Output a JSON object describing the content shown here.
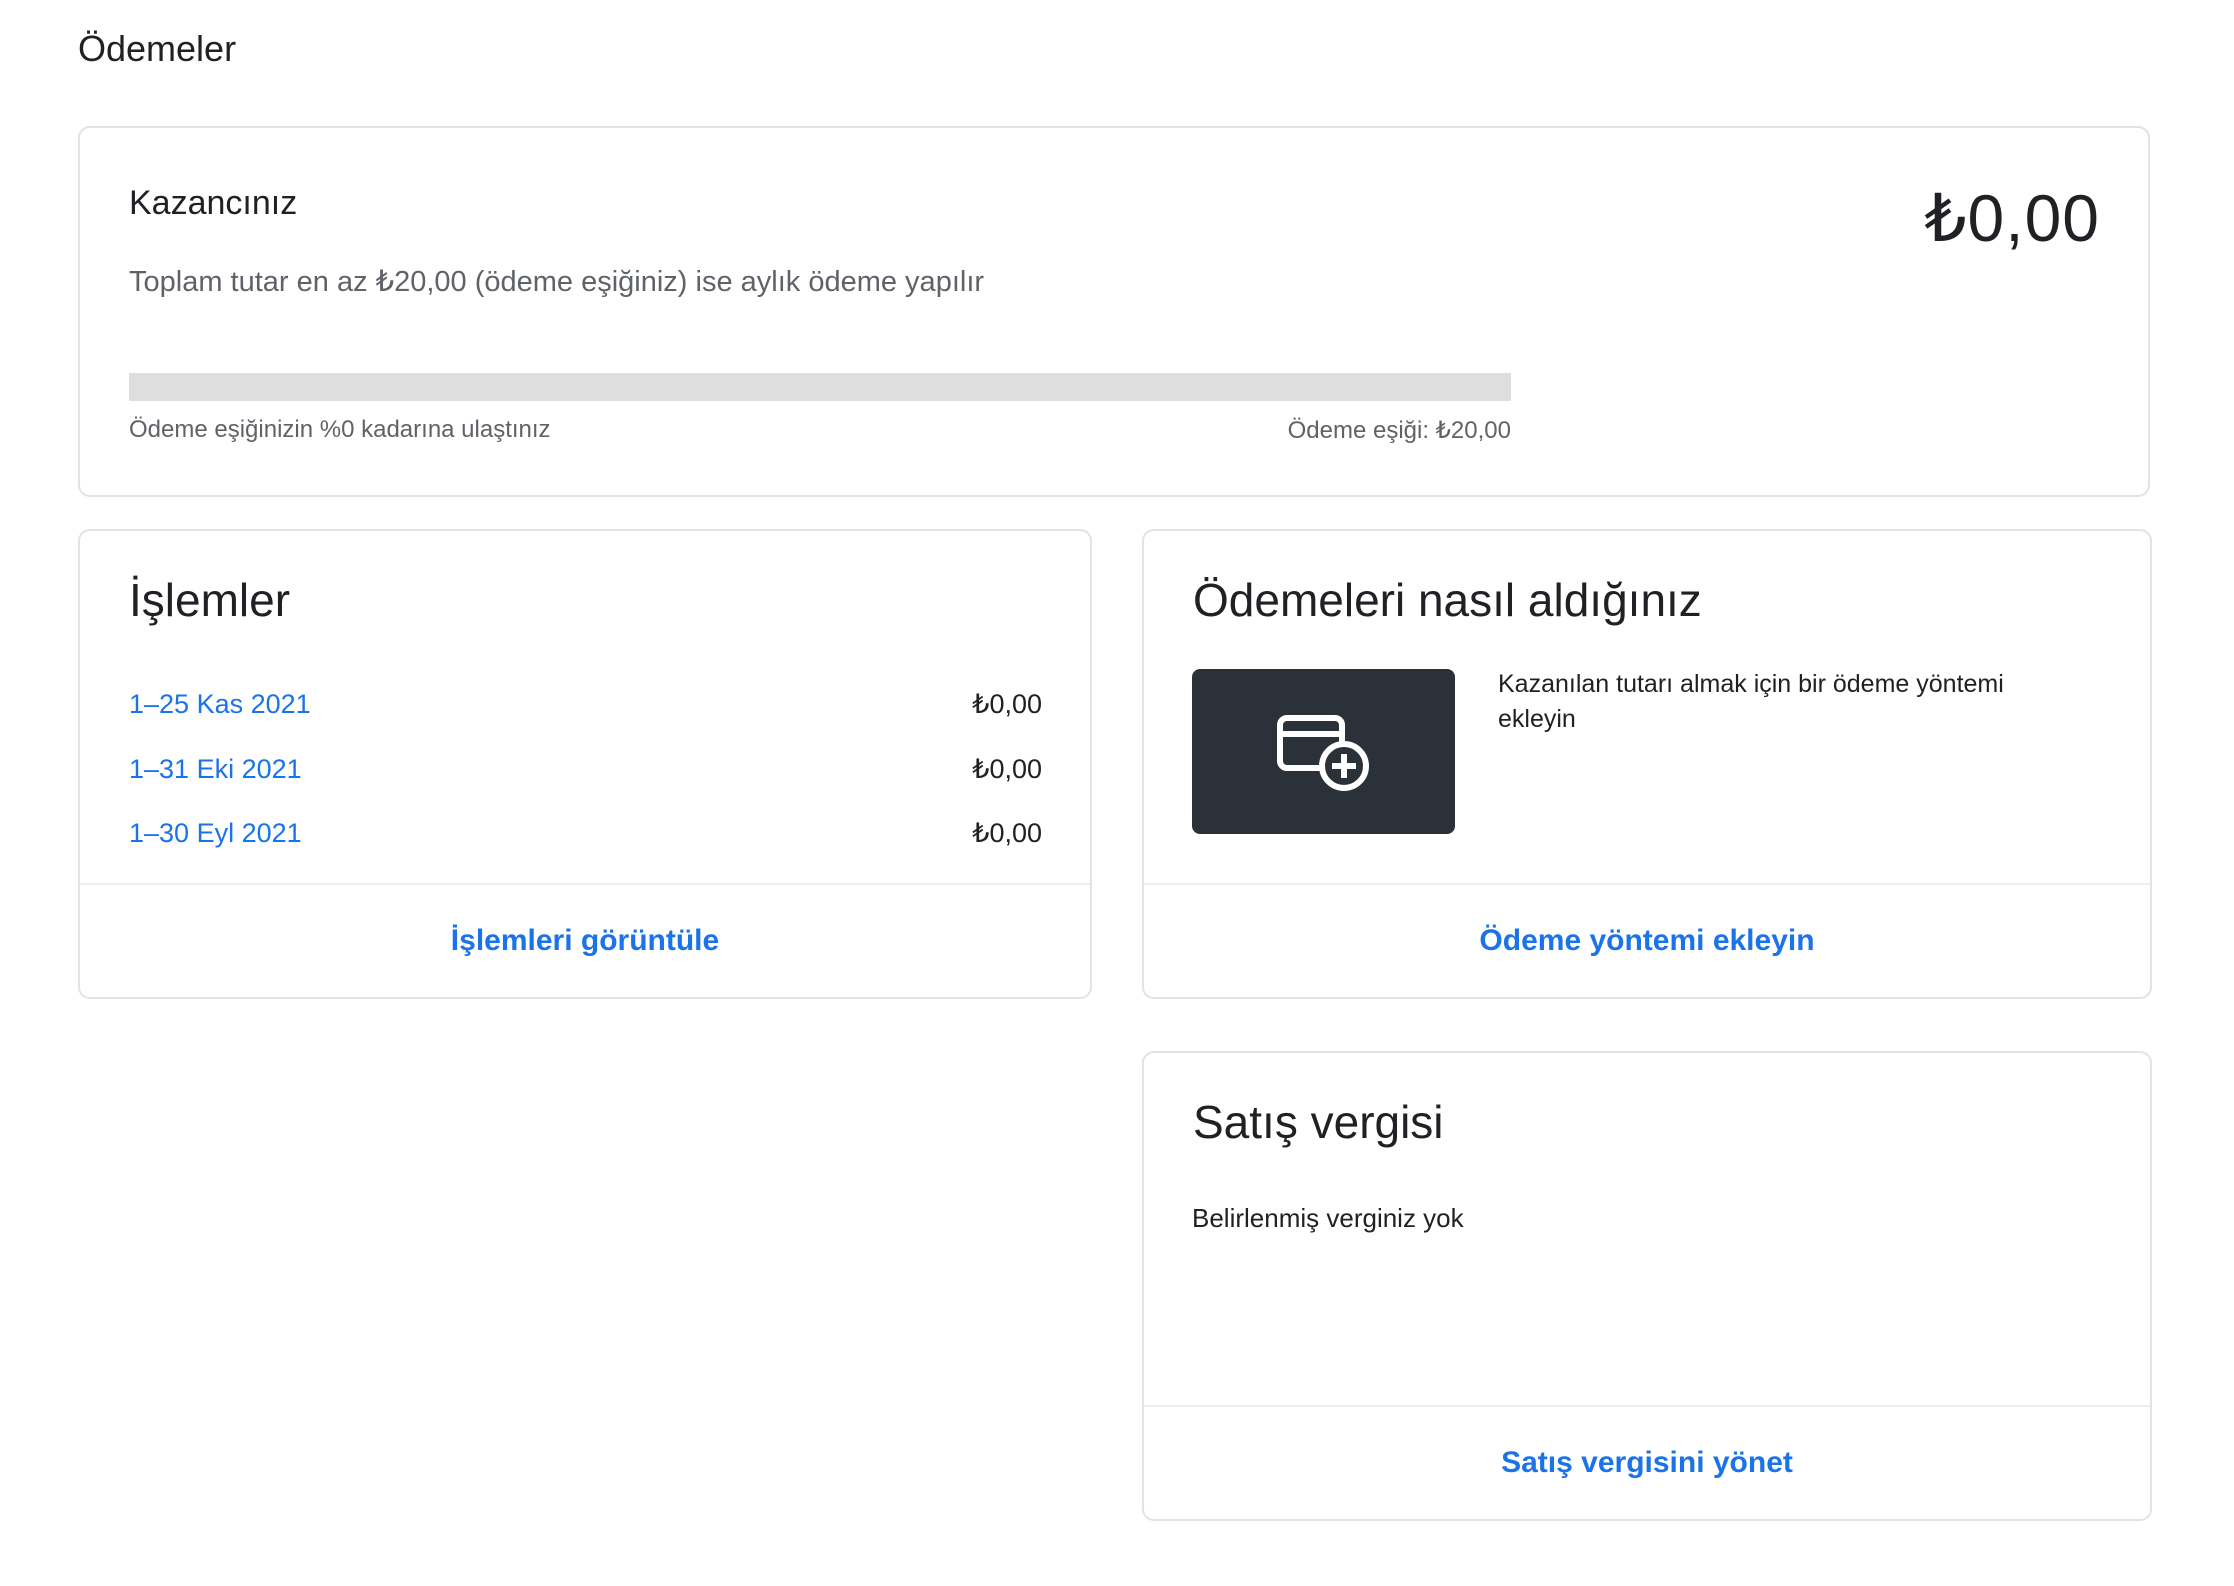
{
  "page": {
    "title": "Ödemeler"
  },
  "earnings": {
    "label": "Kazancınız",
    "amount": "₺0,00",
    "description": "Toplam tutar en az ₺20,00 (ödeme eşiğiniz) ise aylık ödeme yapılır",
    "progress_percent": 0,
    "progress_left_text": "Ödeme eşiğinizin %0 kadarına ulaştınız",
    "progress_right_text": "Ödeme eşiği: ₺20,00"
  },
  "transactions": {
    "title": "İşlemler",
    "rows": [
      {
        "period": "1–25 Kas 2021",
        "amount": "₺0,00"
      },
      {
        "period": "1–31 Eki 2021",
        "amount": "₺0,00"
      },
      {
        "period": "1–30 Eyl 2021",
        "amount": "₺0,00"
      }
    ],
    "footer_link": "İşlemleri görüntüle"
  },
  "payment_method": {
    "title": "Ödemeleri nasıl aldığınız",
    "icon": "add-card-icon",
    "text": "Kazanılan tutarı almak için bir ödeme yöntemi ekleyin",
    "footer_link": "Ödeme yöntemi ekleyin"
  },
  "sales_tax": {
    "title": "Satış vergisi",
    "text": "Belirlenmiş verginiz yok",
    "footer_link": "Satış vergisini yönet"
  },
  "colors": {
    "link": "#1a73e8",
    "tile": "#2b3138",
    "track": "#dedede"
  }
}
